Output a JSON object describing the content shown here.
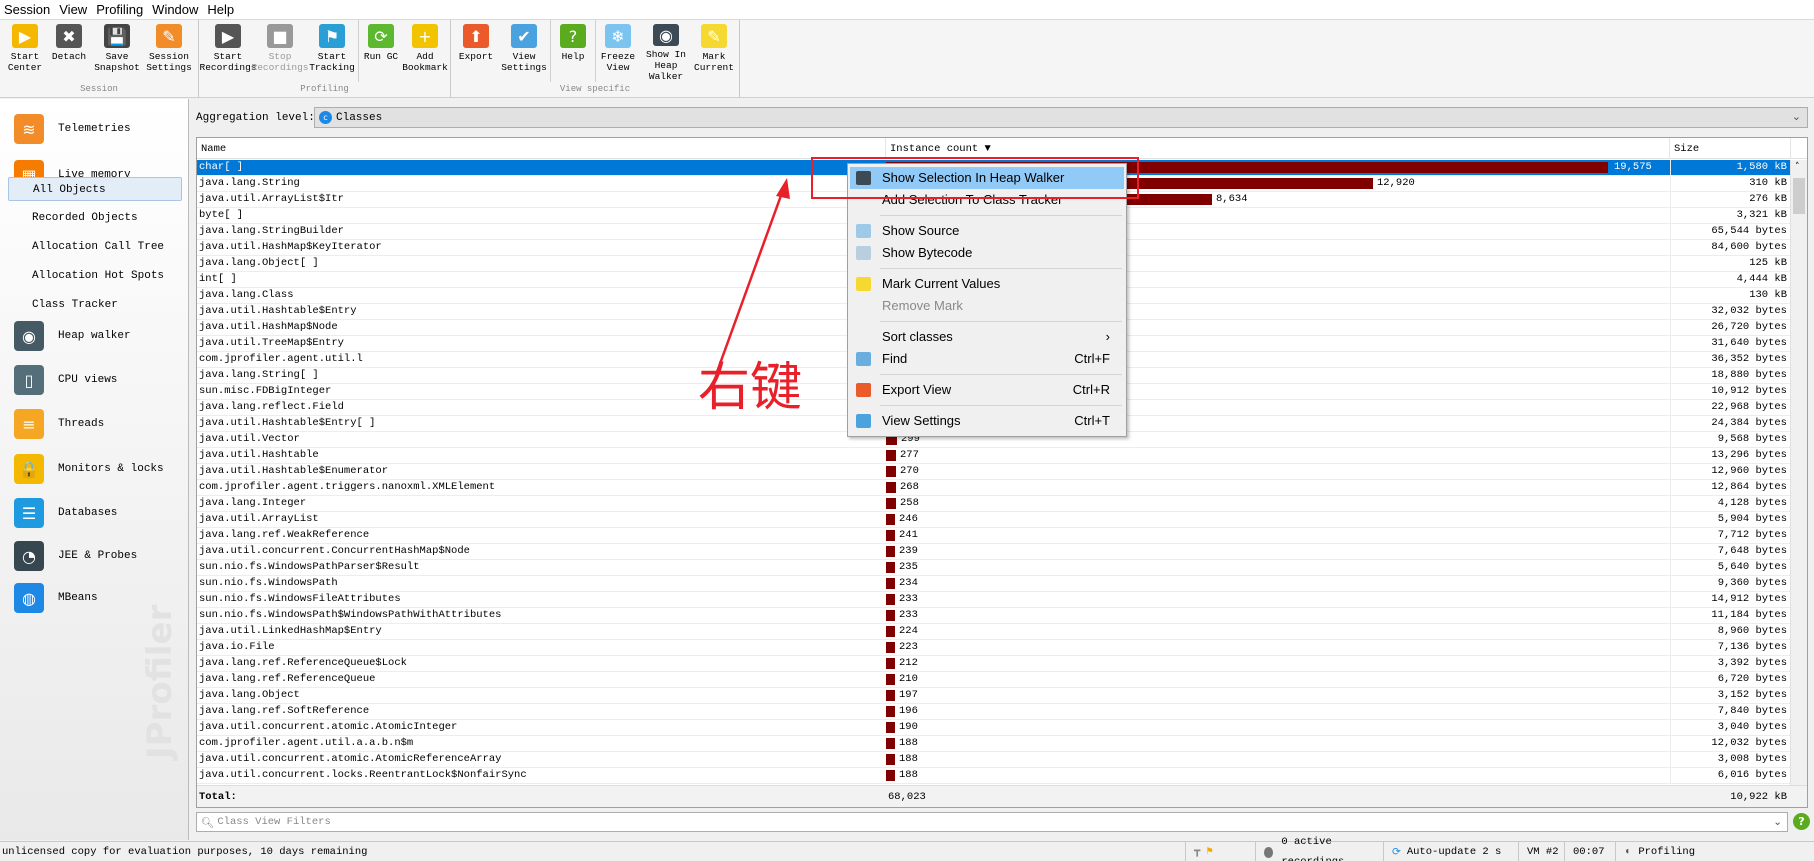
{
  "menu": [
    "Session",
    "View",
    "Profiling",
    "Window",
    "Help"
  ],
  "toolbar": {
    "groups": [
      {
        "label": "Session",
        "subs": [
          [
            {
              "label": "Start Center",
              "icon": "start-center-icon",
              "color": "#f5b800",
              "glyph": "▶"
            },
            {
              "label": "Detach",
              "icon": "detach-icon",
              "color": "#555",
              "glyph": "✖"
            },
            {
              "label": "Save Snapshot",
              "icon": "save-snapshot-icon",
              "color": "#444",
              "glyph": "💾"
            },
            {
              "label": "Session Settings",
              "icon": "session-settings-icon",
              "color": "#f28c28",
              "glyph": "✎"
            }
          ]
        ]
      },
      {
        "label": "Profiling",
        "subs": [
          [
            {
              "label": "Start Recordings",
              "icon": "start-recordings-icon",
              "color": "#555",
              "glyph": "▶"
            },
            {
              "label": "Stop Recordings",
              "icon": "stop-recordings-icon",
              "color": "#999",
              "glyph": "■",
              "disabled": true
            },
            {
              "label": "Start Tracking",
              "icon": "start-tracking-icon",
              "color": "#2a9fd6",
              "glyph": "⚑"
            }
          ],
          [
            {
              "label": "Run GC",
              "icon": "run-gc-icon",
              "color": "#5cb82e",
              "glyph": "⟳"
            },
            {
              "label": "Add Bookmark",
              "icon": "add-bookmark-icon",
              "color": "#f2c400",
              "glyph": "+"
            }
          ]
        ]
      },
      {
        "label": "View specific",
        "subs": [
          [
            {
              "label": "Export",
              "icon": "export-icon",
              "color": "#ea5a2a",
              "glyph": "⬆"
            },
            {
              "label": "View Settings",
              "icon": "view-settings-icon",
              "color": "#4aa3df",
              "glyph": "✔"
            }
          ],
          [
            {
              "label": "Help",
              "icon": "help-icon",
              "color": "#5aab1e",
              "glyph": "?"
            }
          ],
          [
            {
              "label": "Freeze View",
              "icon": "freeze-view-icon",
              "color": "#7cc4f0",
              "glyph": "❄"
            },
            {
              "label": "Show In Heap Walker",
              "icon": "heap-walker-camera-icon",
              "color": "#3c4a56",
              "glyph": "◉"
            },
            {
              "label": "Mark Current",
              "icon": "mark-current-icon",
              "color": "#f5d830",
              "glyph": "✎"
            }
          ]
        ]
      }
    ]
  },
  "sidebar": {
    "items": [
      {
        "label": "Telemetries",
        "icon": "telemetries-icon",
        "color": "#f28c28",
        "glyph": "≋"
      },
      {
        "label": "Live memory",
        "icon": "live-memory-icon",
        "color": "#f57c00",
        "glyph": "▦"
      },
      {
        "label": "Heap walker",
        "icon": "heap-walker-icon",
        "color": "#455a64",
        "glyph": "◉"
      },
      {
        "label": "CPU views",
        "icon": "cpu-views-icon",
        "color": "#546e7a",
        "glyph": "▯"
      },
      {
        "label": "Threads",
        "icon": "threads-icon",
        "color": "#f5a623",
        "glyph": "≡"
      },
      {
        "label": "Monitors & locks",
        "icon": "lock-icon",
        "color": "#f5b800",
        "glyph": "🔒"
      },
      {
        "label": "Databases",
        "icon": "databases-icon",
        "color": "#1e9be0",
        "glyph": "☰"
      },
      {
        "label": "JEE & Probes",
        "icon": "gauge-icon",
        "color": "#37474f",
        "glyph": "◔"
      },
      {
        "label": "MBeans",
        "icon": "globe-icon",
        "color": "#1e88e5",
        "glyph": "◍"
      }
    ],
    "subitems": [
      "All Objects",
      "Recorded Objects",
      "Allocation Call Tree",
      "Allocation Hot Spots",
      "Class Tracker"
    ],
    "active_subitem": "All Objects",
    "watermark": "JProfiler"
  },
  "aggregation": {
    "label": "Aggregation level:",
    "value": "Classes"
  },
  "table": {
    "columns": {
      "name": "Name",
      "count": "Instance count ▼",
      "size": "Size"
    },
    "max_count": 19575,
    "bar_color": "#800000",
    "rows": [
      {
        "name": "char[ ]",
        "count": "19,575",
        "size": "1,580 kB",
        "selected": true
      },
      {
        "name": "java.lang.String",
        "count": "12,920",
        "size": "310 kB"
      },
      {
        "name": "java.util.ArrayList$Itr",
        "count": "8,634",
        "size": "276 kB"
      },
      {
        "name": "byte[ ]",
        "count": null,
        "size": "3,321 kB"
      },
      {
        "name": "java.lang.StringBuilder",
        "count": null,
        "size": "65,544 bytes"
      },
      {
        "name": "java.util.HashMap$KeyIterator",
        "count": null,
        "size": "84,600 bytes"
      },
      {
        "name": "java.lang.Object[ ]",
        "count": null,
        "size": "125 kB"
      },
      {
        "name": "int[ ]",
        "count": null,
        "size": "4,444 kB"
      },
      {
        "name": "java.lang.Class",
        "count": null,
        "size": "130 kB"
      },
      {
        "name": "java.util.Hashtable$Entry",
        "count": null,
        "size": "32,032 bytes"
      },
      {
        "name": "java.util.HashMap$Node",
        "count": null,
        "size": "26,720 bytes"
      },
      {
        "name": "java.util.TreeMap$Entry",
        "count": null,
        "size": "31,640 bytes"
      },
      {
        "name": "com.jprofiler.agent.util.l",
        "count": null,
        "size": "36,352 bytes"
      },
      {
        "name": "java.lang.String[ ]",
        "count": null,
        "size": "18,880 bytes"
      },
      {
        "name": "sun.misc.FDBigInteger",
        "count": null,
        "size": "10,912 bytes"
      },
      {
        "name": "java.lang.reflect.Field",
        "count": null,
        "size": "22,968 bytes"
      },
      {
        "name": "java.util.Hashtable$Entry[ ]",
        "count": null,
        "size": "24,384 bytes"
      },
      {
        "name": "java.util.Vector",
        "count": "299",
        "size": "9,568 bytes"
      },
      {
        "name": "java.util.Hashtable",
        "count": "277",
        "size": "13,296 bytes"
      },
      {
        "name": "java.util.Hashtable$Enumerator",
        "count": "270",
        "size": "12,960 bytes"
      },
      {
        "name": "com.jprofiler.agent.triggers.nanoxml.XMLElement",
        "count": "268",
        "size": "12,864 bytes"
      },
      {
        "name": "java.lang.Integer",
        "count": "258",
        "size": "4,128 bytes"
      },
      {
        "name": "java.util.ArrayList",
        "count": "246",
        "size": "5,904 bytes"
      },
      {
        "name": "java.lang.ref.WeakReference",
        "count": "241",
        "size": "7,712 bytes"
      },
      {
        "name": "java.util.concurrent.ConcurrentHashMap$Node",
        "count": "239",
        "size": "7,648 bytes"
      },
      {
        "name": "sun.nio.fs.WindowsPathParser$Result",
        "count": "235",
        "size": "5,640 bytes"
      },
      {
        "name": "sun.nio.fs.WindowsPath",
        "count": "234",
        "size": "9,360 bytes"
      },
      {
        "name": "sun.nio.fs.WindowsFileAttributes",
        "count": "233",
        "size": "14,912 bytes"
      },
      {
        "name": "sun.nio.fs.WindowsPath$WindowsPathWithAttributes",
        "count": "233",
        "size": "11,184 bytes"
      },
      {
        "name": "java.util.LinkedHashMap$Entry",
        "count": "224",
        "size": "8,960 bytes"
      },
      {
        "name": "java.io.File",
        "count": "223",
        "size": "7,136 bytes"
      },
      {
        "name": "java.lang.ref.ReferenceQueue$Lock",
        "count": "212",
        "size": "3,392 bytes"
      },
      {
        "name": "java.lang.ref.ReferenceQueue",
        "count": "210",
        "size": "6,720 bytes"
      },
      {
        "name": "java.lang.Object",
        "count": "197",
        "size": "3,152 bytes"
      },
      {
        "name": "java.lang.ref.SoftReference",
        "count": "196",
        "size": "7,840 bytes"
      },
      {
        "name": "java.util.concurrent.atomic.AtomicInteger",
        "count": "190",
        "size": "3,040 bytes"
      },
      {
        "name": "com.jprofiler.agent.util.a.a.b.n$m",
        "count": "188",
        "size": "12,032 bytes"
      },
      {
        "name": "java.util.concurrent.atomic.AtomicReferenceArray",
        "count": "188",
        "size": "3,008 bytes"
      },
      {
        "name": "java.util.concurrent.locks.ReentrantLock$NonfairSync",
        "count": "188",
        "size": "6,016 bytes"
      }
    ],
    "total": {
      "label": "Total:",
      "count": "68,023",
      "size": "10,922 kB"
    }
  },
  "filter": {
    "placeholder": "Class View Filters"
  },
  "context_menu": {
    "items": [
      {
        "label": "Show Selection In Heap Walker",
        "icon": "camera-icon",
        "highlighted": true
      },
      {
        "label": "Add Selection To Class Tracker"
      },
      {
        "sep": true
      },
      {
        "label": "Show Source",
        "icon": "source-icon"
      },
      {
        "label": "Show Bytecode",
        "icon": "bytecode-icon"
      },
      {
        "sep": true
      },
      {
        "label": "Mark Current Values",
        "icon": "mark-icon"
      },
      {
        "label": "Remove Mark",
        "disabled": true
      },
      {
        "sep": true
      },
      {
        "label": "Sort classes",
        "submenu": true
      },
      {
        "label": "Find",
        "icon": "find-icon",
        "shortcut": "Ctrl+F"
      },
      {
        "sep": true
      },
      {
        "label": "Export View",
        "icon": "export-icon",
        "shortcut": "Ctrl+R"
      },
      {
        "sep": true
      },
      {
        "label": "View Settings",
        "icon": "view-settings-icon",
        "shortcut": "Ctrl+T"
      }
    ]
  },
  "annotation": {
    "text": "右键",
    "color": "#e8202a"
  },
  "status": {
    "license": "unlicensed copy for evaluation purposes, 10 days remaining",
    "recordings": "0 active recordings",
    "autoupdate": "Auto-update 2 s",
    "vm": "VM #2",
    "time": "00:07",
    "mode": "Profiling"
  }
}
